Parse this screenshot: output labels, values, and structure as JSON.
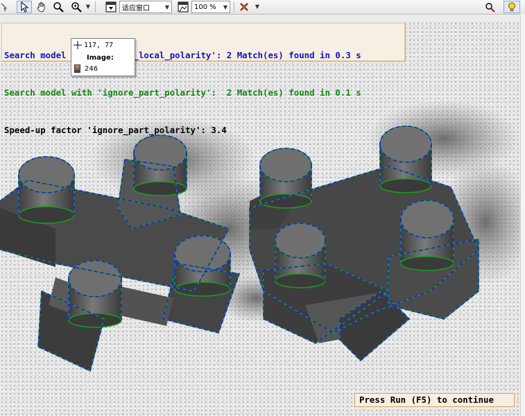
{
  "toolbar": {
    "zoom_mode": "适应窗口",
    "zoom_percent": "100 %"
  },
  "messages": [
    {
      "text": "Search model with 'ignore_local_polarity': 2 Match(es) found in 0.3 s",
      "color": "#1414c8"
    },
    {
      "text": "Search model with 'ignore_part_polarity':  2 Match(es) found in 0.1 s",
      "color": "#0f8a0f"
    },
    {
      "text": "Speed-up factor 'ignore_part_polarity': 3.4",
      "color": "#000000"
    }
  ],
  "tooltip": {
    "coords": "117, 77",
    "label": "Image:",
    "value": "246"
  },
  "status": {
    "text": "Press Run (F5) to continue"
  },
  "colors": {
    "model_outline_blue": "#1e1ee6",
    "model_outline_green": "#1a9a1a",
    "message_background": "#f6efe3"
  }
}
